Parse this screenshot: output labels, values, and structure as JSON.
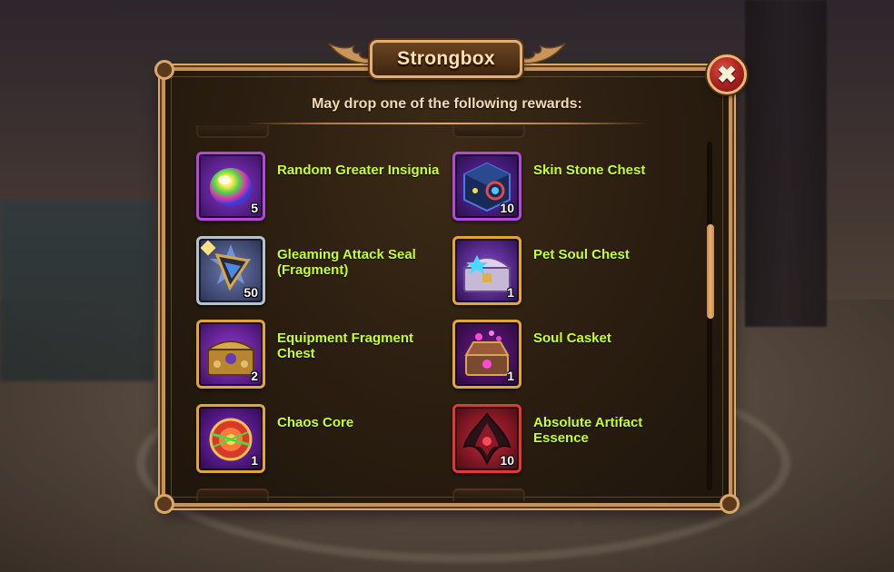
{
  "dialog": {
    "title": "Strongbox",
    "subtitle": "May drop one of the following rewards:",
    "close_label": "✖"
  },
  "rewards": [
    {
      "name": "Random Greater Insignia",
      "qty": "5",
      "frame": "purple",
      "icon": "rainbow-orb-icon"
    },
    {
      "name": "Skin Stone Chest",
      "qty": "10",
      "frame": "purple",
      "icon": "skin-stone-cube-icon"
    },
    {
      "name": "Gleaming Attack Seal (Fragment)",
      "qty": "50",
      "frame": "silver",
      "icon": "attack-seal-icon"
    },
    {
      "name": "Pet Soul Chest",
      "qty": "1",
      "frame": "gold",
      "icon": "pet-soul-chest-icon"
    },
    {
      "name": "Equipment Fragment Chest",
      "qty": "2",
      "frame": "gold",
      "icon": "equipment-chest-icon"
    },
    {
      "name": "Soul Casket",
      "qty": "1",
      "frame": "gold",
      "icon": "soul-casket-icon"
    },
    {
      "name": "Chaos Core",
      "qty": "1",
      "frame": "gold",
      "icon": "chaos-core-icon"
    },
    {
      "name": "Absolute Artifact Essence",
      "qty": "10",
      "frame": "red",
      "icon": "artifact-essence-icon"
    }
  ],
  "colors": {
    "reward_text": "#c8ff2a",
    "frame_border": "#c7925a",
    "close_button": "#a82020"
  }
}
